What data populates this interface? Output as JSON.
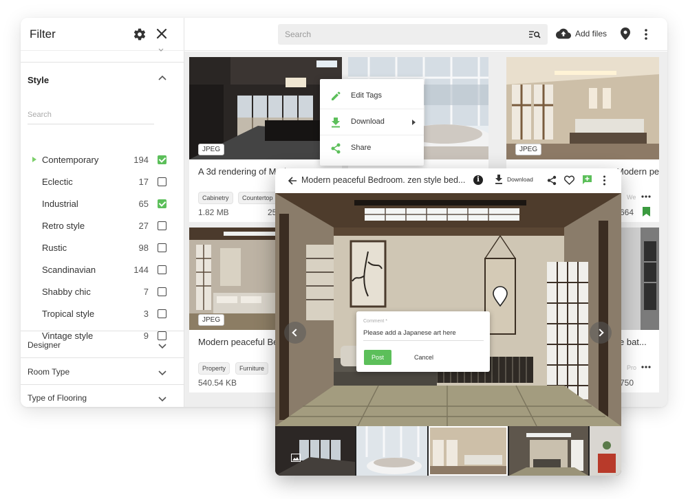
{
  "sidebar": {
    "title": "Filter",
    "style_section": {
      "title": "Style",
      "search_placeholder": "Search",
      "items": [
        {
          "label": "Contemporary",
          "count": "194",
          "checked": true
        },
        {
          "label": "Eclectic",
          "count": "17",
          "checked": false
        },
        {
          "label": "Industrial",
          "count": "65",
          "checked": true
        },
        {
          "label": "Retro style",
          "count": "27",
          "checked": false
        },
        {
          "label": "Rustic",
          "count": "98",
          "checked": false
        },
        {
          "label": "Scandinavian",
          "count": "144",
          "checked": false
        },
        {
          "label": "Shabby chic",
          "count": "7",
          "checked": false
        },
        {
          "label": "Tropical style",
          "count": "3",
          "checked": false
        },
        {
          "label": "Vintage style",
          "count": "9",
          "checked": false
        }
      ]
    },
    "sections": [
      "Designer",
      "Room Type",
      "Type of Flooring"
    ]
  },
  "topbar": {
    "search_placeholder": "Search",
    "add_files_label": "Add files"
  },
  "grid": {
    "cards": [
      {
        "badge": "JPEG",
        "title": "A 3d rendering of Modern Det",
        "chips": [
          "Cabinetry",
          "Countertop"
        ],
        "size": "1.82 MB",
        "size_tail": "25"
      },
      {
        "badge": "",
        "title": "",
        "chips": [],
        "size": ""
      },
      {
        "badge": "JPEG",
        "title": "Modern peaceful Bedroom. j...",
        "chips": [
          "We"
        ],
        "size": "664"
      },
      {
        "badge": "JPEG",
        "title": "Modern peaceful Be",
        "chips": [
          "Property",
          "Furniture"
        ],
        "size": "540.54 KB"
      },
      {
        "badge": "",
        "title": "e bat...",
        "chips": [
          "Pro"
        ],
        "size": "750"
      }
    ]
  },
  "context_menu": {
    "items": [
      "Edit Tags",
      "Download",
      "Share"
    ]
  },
  "viewer": {
    "title": "Modern peaceful Bedroom. zen style bed...",
    "download_label": "Download",
    "comment": {
      "label": "Comment *",
      "value": "Please add a Japanese art here",
      "post_label": "Post",
      "cancel_label": "Cancel"
    }
  },
  "colors": {
    "accent_green": "#5cbf5a",
    "bookmark_green": "#3a9a3f",
    "grid_bg": "#eeeeee"
  }
}
